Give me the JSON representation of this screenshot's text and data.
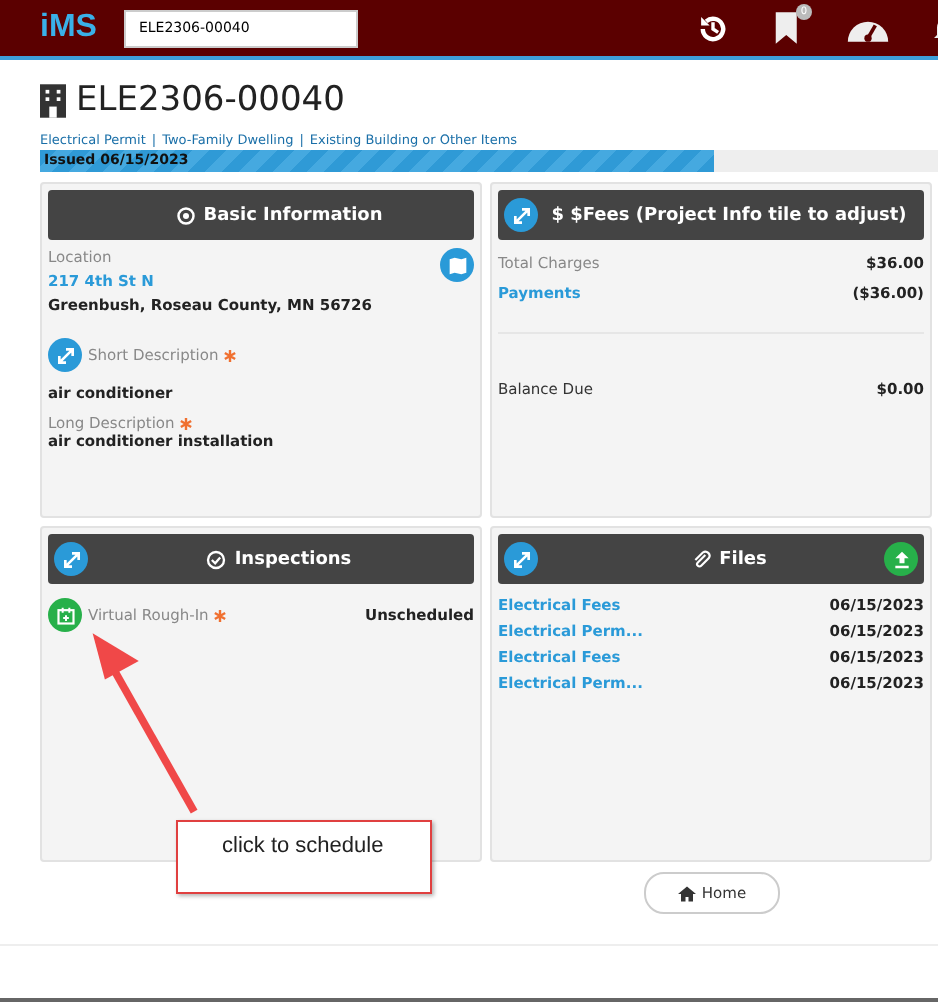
{
  "header": {
    "logo": "iMS",
    "search_value": "ELE2306-00040",
    "badge": "0"
  },
  "title": "ELE2306-00040",
  "breadcrumb": [
    "Electrical Permit",
    "Two-Family Dwelling",
    "Existing Building or Other Items"
  ],
  "breadcrumb_separator": "|",
  "status": {
    "label": "Issued 06/15/2023",
    "level": 0.75
  },
  "basic": {
    "title": "Basic Information",
    "location_label": "Location",
    "address": "217 4th St N",
    "city": "Greenbush, Roseau County, MN 56726",
    "short_label": "Short Description",
    "short_required": true,
    "short_value": "air conditioner",
    "long_label": "Long Description",
    "long_required": true,
    "long_value": "air conditioner installation"
  },
  "fees": {
    "title": "$ $Fees (Project Info tile to adjust)",
    "rows": [
      {
        "label": "Total Charges",
        "value": "$36.00",
        "kind": "muted"
      },
      {
        "label": "Payments",
        "value": "($36.00)",
        "kind": "link"
      }
    ],
    "balance": {
      "label": "Balance Due",
      "value": "$0.00"
    }
  },
  "inspections": {
    "title": "Inspections",
    "items": [
      {
        "name": "Virtual Rough-In",
        "required": true,
        "status": "Unscheduled"
      }
    ]
  },
  "files": {
    "title": "Files",
    "items": [
      {
        "name": "Electrical Fees",
        "date": "06/15/2023"
      },
      {
        "name": "Electrical Perm...",
        "date": "06/15/2023"
      },
      {
        "name": "Electrical Fees",
        "date": "06/15/2023"
      },
      {
        "name": "Electrical Perm...",
        "date": "06/15/2023"
      }
    ]
  },
  "home_button": "Home",
  "annotation": "click to schedule"
}
